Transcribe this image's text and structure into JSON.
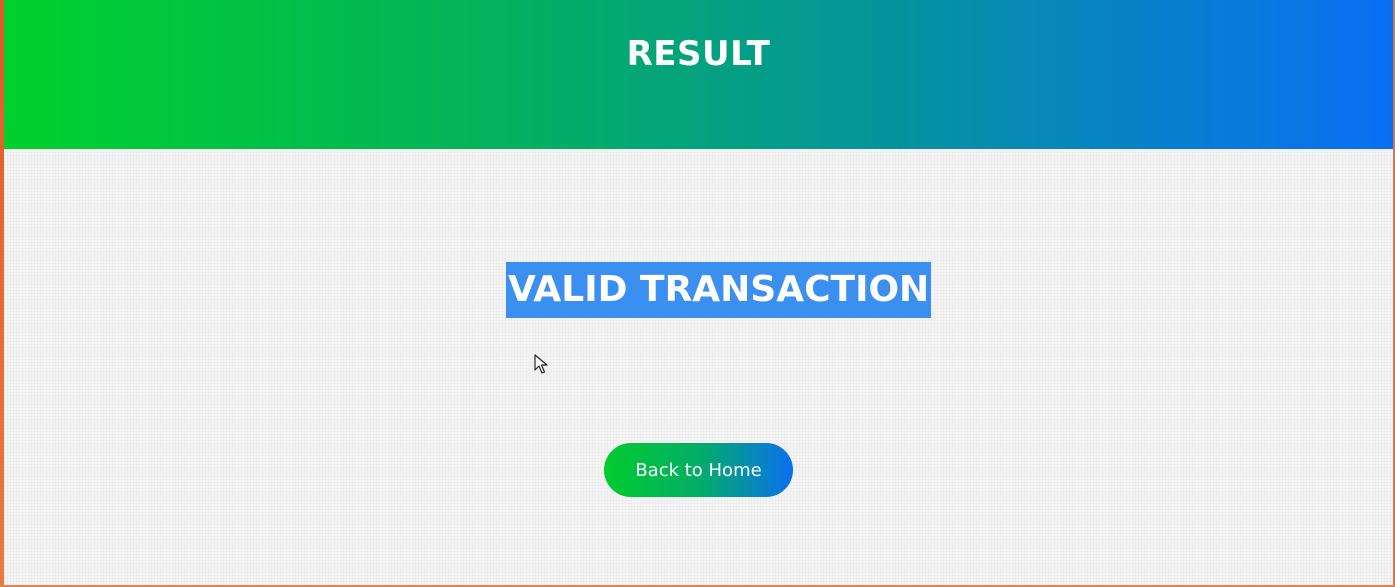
{
  "header": {
    "title": "RESULT"
  },
  "main": {
    "status_text": "VALID TRANSACTION",
    "back_button_label": "Back to Home"
  },
  "colors": {
    "header_gradient_start": "#00d12d",
    "header_gradient_end": "#0a6ff5",
    "selection_highlight": "#3b8ff0",
    "button_gradient_start": "#00cc2e",
    "button_gradient_end": "#0a6ff0"
  },
  "icons": {
    "cursor": "mouse-pointer-icon"
  }
}
